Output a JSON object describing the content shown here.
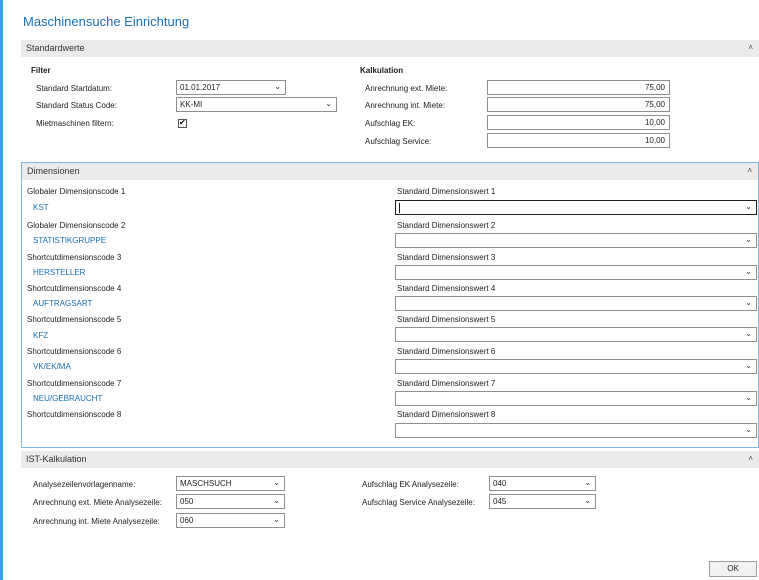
{
  "page_title": "Maschinensuche Einrichtung",
  "standardwerte": {
    "header": "Standardwerte",
    "filter": {
      "group_label": "Filter",
      "startdatum_label": "Standard Startdatum:",
      "startdatum_value": "01.01.2017",
      "status_label": "Standard Status Code:",
      "status_value": "KK-MI",
      "mietmaschinen_label": "Mietmaschinen filtern:",
      "mietmaschinen_checked": "✔"
    },
    "kalkulation": {
      "group_label": "Kalkulation",
      "rows": [
        {
          "label": "Anrechnung ext. Miete:",
          "value": "75,00"
        },
        {
          "label": "Anrechnung int. Miete:",
          "value": "75,00"
        },
        {
          "label": "Aufschlag EK:",
          "value": "10,00"
        },
        {
          "label": "Aufschlag Service:",
          "value": "10,00"
        }
      ]
    }
  },
  "dimensionen": {
    "header": "Dimensionen",
    "rows": [
      {
        "code_label": "Globaler Dimensionscode 1",
        "code_value": "KST",
        "wert_label": "Standard Dimensionswert 1",
        "wert_value": ""
      },
      {
        "code_label": "Globaler Dimensionscode 2",
        "code_value": "STATISTIKGRUPPE",
        "wert_label": "Standard Dimensionswert 2",
        "wert_value": ""
      },
      {
        "code_label": "Shortcutdimensionscode 3",
        "code_value": "HERSTELLER",
        "wert_label": "Standard Dimensionswert 3",
        "wert_value": ""
      },
      {
        "code_label": "Shortcutdimensionscode 4",
        "code_value": "AUFTRAGSART",
        "wert_label": "Standard Dimensionswert 4",
        "wert_value": ""
      },
      {
        "code_label": "Shortcutdimensionscode 5",
        "code_value": "KFZ",
        "wert_label": "Standard Dimensionswert 5",
        "wert_value": ""
      },
      {
        "code_label": "Shortcutdimensionscode 6",
        "code_value": "VK/EK/MA",
        "wert_label": "Standard Dimensionswert 6",
        "wert_value": ""
      },
      {
        "code_label": "Shortcutdimensionscode 7",
        "code_value": "NEU/GEBRAUCHT",
        "wert_label": "Standard Dimensionswert 7",
        "wert_value": ""
      },
      {
        "code_label": "Shortcutdimensionscode 8",
        "code_value": "",
        "wert_label": "Standard Dimensionswert 8",
        "wert_value": ""
      }
    ]
  },
  "ist_kalkulation": {
    "header": "IST-Kalkulation",
    "left": [
      {
        "label": "Analysezeilenvorlagenname:",
        "value": "MASCHSUCH"
      },
      {
        "label": "Anrechnung ext. Miete Analysezeile:",
        "value": "050"
      },
      {
        "label": "Anrechnung int. Miete Analysezeile:",
        "value": "060"
      }
    ],
    "right": [
      {
        "label": "Aufschlag EK Analysezeile:",
        "value": "040"
      },
      {
        "label": "Aufschlag Service Analysezeile:",
        "value": "045"
      }
    ]
  },
  "ok_label": "OK",
  "icons": {
    "chevron_down": "⌄",
    "collapse": "˄"
  }
}
